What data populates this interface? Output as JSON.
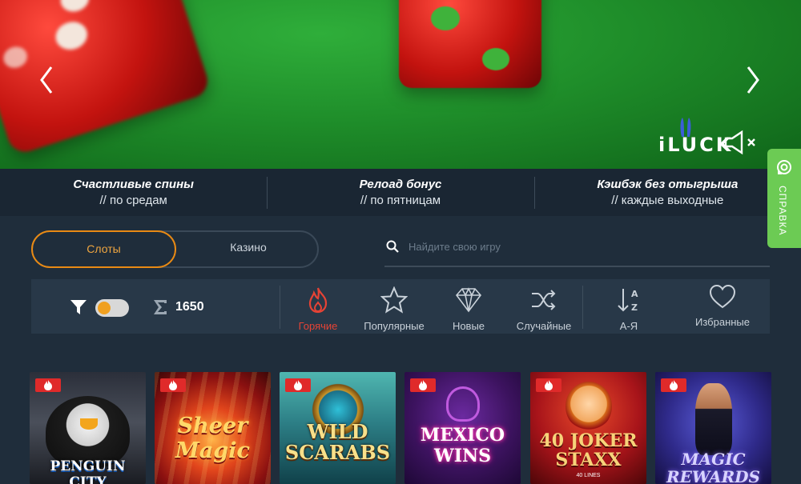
{
  "hero": {
    "logo_text": "iLUCK"
  },
  "promo": [
    {
      "title": "Счастливые спины",
      "subtitle": "// по средам"
    },
    {
      "title": "Релоад бонус",
      "subtitle": "// по пятницам"
    },
    {
      "title": "Кэшбэк без отыгрыша",
      "subtitle": "// каждые выходные"
    }
  ],
  "help": {
    "label": "СПРАВКА"
  },
  "tabs": [
    {
      "label": "Слоты"
    },
    {
      "label": "Казино"
    }
  ],
  "search": {
    "placeholder": "Найдите свою игру"
  },
  "filter": {
    "count": "1650"
  },
  "categories": [
    {
      "label": "Горячие",
      "icon": "flame-icon"
    },
    {
      "label": "Популярные",
      "icon": "star-icon"
    },
    {
      "label": "Новые",
      "icon": "diamond-icon"
    },
    {
      "label": "Случайные",
      "icon": "shuffle-icon"
    },
    {
      "label": "А-Я",
      "icon": "sort-az-icon"
    },
    {
      "label": "Избранные",
      "icon": "heart-icon"
    }
  ],
  "games": [
    {
      "title": "PENGUIN CITY"
    },
    {
      "title": "Sheer Magic"
    },
    {
      "title": "WILD SCARABS"
    },
    {
      "title": "MEXICO WINS"
    },
    {
      "title": "40 JOKER STAXX",
      "sub": "40 LINES"
    },
    {
      "title": "MAGIC REWARDS"
    }
  ],
  "colors": {
    "accent_orange": "#e98a14",
    "hot_red": "#e64335",
    "help_green": "#6ccb54",
    "page_bg": "#1f2d3b"
  }
}
